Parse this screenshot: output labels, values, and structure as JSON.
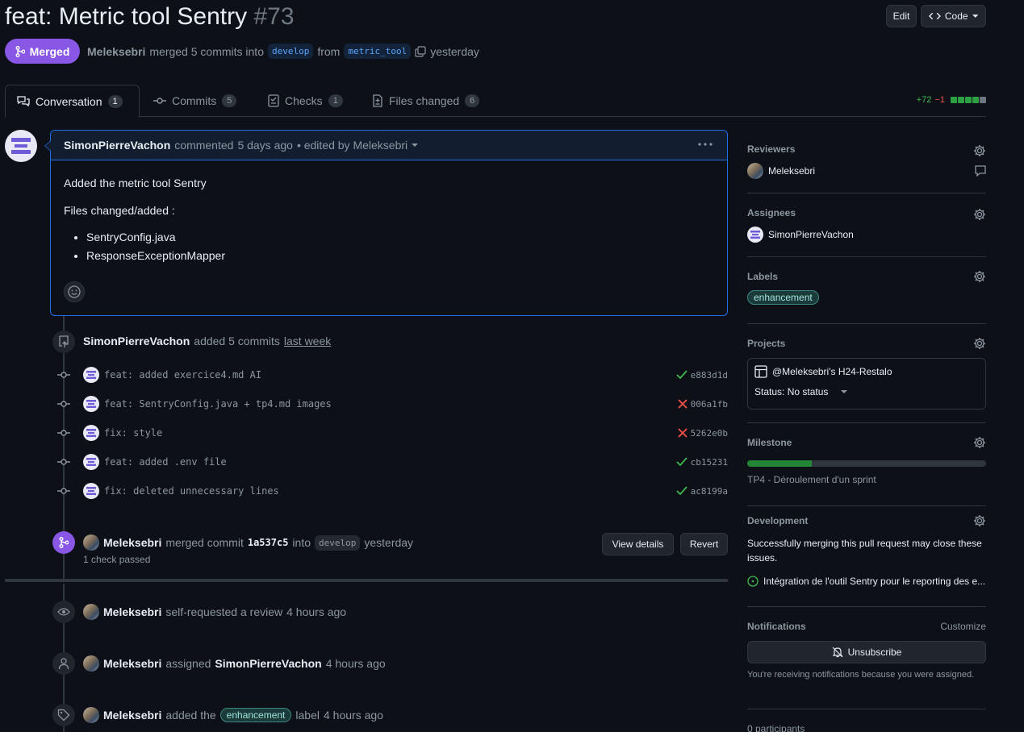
{
  "pr": {
    "title": "feat: Metric tool Sentry",
    "number": "#73",
    "state": "Merged",
    "author": "Meleksebri",
    "merged_text": "merged 5 commits into",
    "base_branch": "develop",
    "from_text": "from",
    "head_branch": "metric_tool",
    "time": "yesterday"
  },
  "header_buttons": {
    "edit": "Edit",
    "code": "Code"
  },
  "tabs": [
    {
      "label": "Conversation",
      "count": "1"
    },
    {
      "label": "Commits",
      "count": "5"
    },
    {
      "label": "Checks",
      "count": "1"
    },
    {
      "label": "Files changed",
      "count": "6"
    }
  ],
  "diffstat": {
    "additions": "+72",
    "deletions": "−1",
    "colors": [
      "#2ea043",
      "#2ea043",
      "#2ea043",
      "#2ea043",
      "#6e7681"
    ]
  },
  "comment": {
    "author": "SimonPierreVachon",
    "action": "commented",
    "time": "5 days ago",
    "edited": "• edited by Meleksebri",
    "line1": "Added the metric tool Sentry",
    "line2": "Files changed/added :",
    "items": [
      "SentryConfig.java",
      "ResponseExceptionMapper"
    ]
  },
  "commits_event": {
    "author": "SimonPierreVachon",
    "text": "added 5 commits",
    "time": "last week"
  },
  "commits": [
    {
      "message": "feat: added exercice4.md AI",
      "status": "success",
      "sha": "e883d1d"
    },
    {
      "message": "feat: SentryConfig.java + tp4.md images",
      "status": "failure",
      "sha": "006a1fb"
    },
    {
      "message": "fix: style",
      "status": "failure",
      "sha": "5262e0b"
    },
    {
      "message": "feat: added .env file",
      "status": "success",
      "sha": "cb15231"
    },
    {
      "message": "fix: deleted unnecessary lines",
      "status": "success",
      "sha": "ac8199a"
    }
  ],
  "merge_event": {
    "author": "Meleksebri",
    "text": "merged commit",
    "sha": "1a537c5",
    "into": "into",
    "branch": "develop",
    "time": "yesterday",
    "checks": "1 check passed",
    "view_details": "View details",
    "revert": "Revert"
  },
  "events": [
    {
      "author": "Meleksebri",
      "text": "self-requested a review",
      "time": "4 hours ago"
    },
    {
      "author": "Meleksebri",
      "text": "assigned",
      "target": "SimonPierreVachon",
      "time": "4 hours ago"
    },
    {
      "author": "Meleksebri",
      "text": "added the",
      "label": "enhancement",
      "after": "label",
      "time": "4 hours ago"
    }
  ],
  "sidebar": {
    "reviewers": {
      "title": "Reviewers",
      "name": "Meleksebri"
    },
    "assignees": {
      "title": "Assignees",
      "name": "SimonPierreVachon"
    },
    "labels": {
      "title": "Labels",
      "label": "enhancement"
    },
    "projects": {
      "title": "Projects",
      "name": "@Meleksebri's H24-Restalo",
      "status": "Status: No status"
    },
    "milestone": {
      "title": "Milestone",
      "name": "TP4 - Déroulement d'un sprint",
      "progress": 0.27
    },
    "development": {
      "title": "Development",
      "text": "Successfully merging this pull request may close these issues.",
      "issue": "Intégration de l'outil Sentry pour le reporting des e..."
    },
    "notifications": {
      "title": "Notifications",
      "customize": "Customize",
      "button": "Unsubscribe",
      "text": "You're receiving notifications because you were assigned."
    },
    "participants": "0 participants"
  },
  "colors": {
    "accent_merged": "#8957e5",
    "success": "#3fb950",
    "failure": "#f85149",
    "link": "#58a6ff"
  }
}
